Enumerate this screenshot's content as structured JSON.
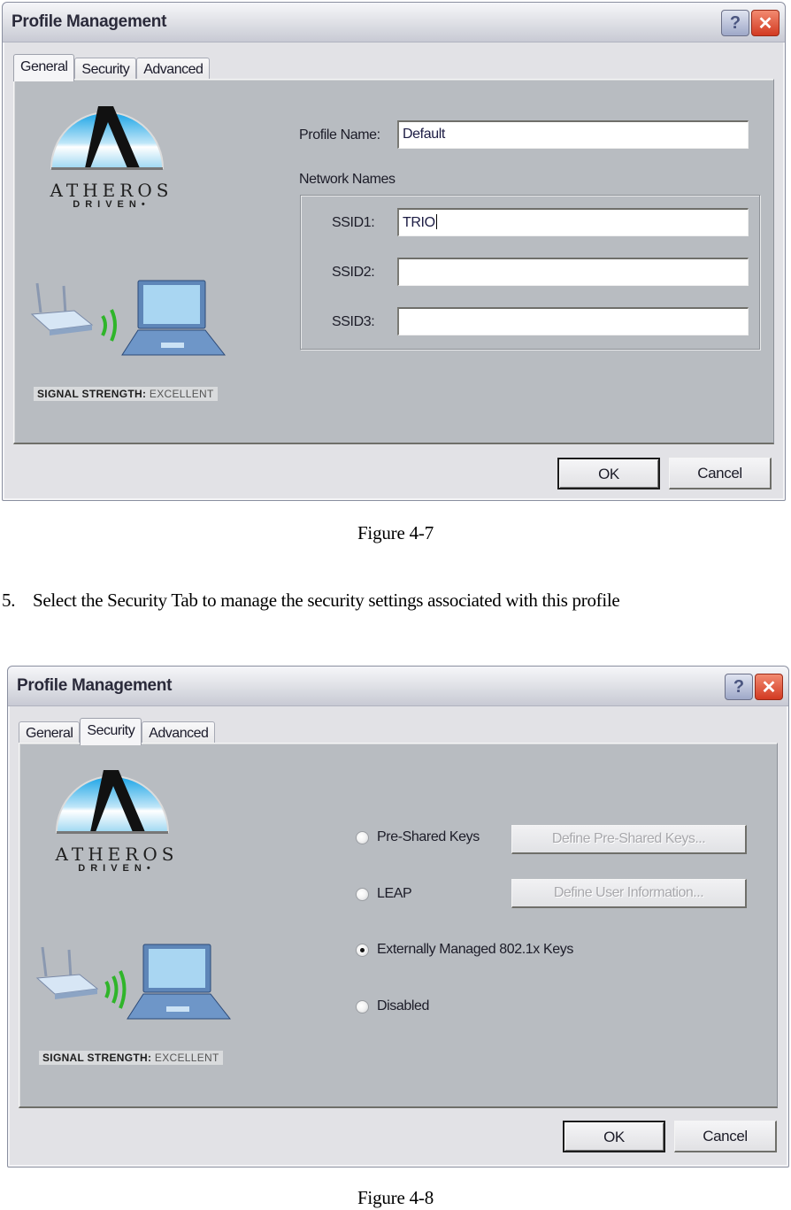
{
  "figures": [
    {
      "caption": "Figure 4-7",
      "dialog": {
        "title": "Profile Management",
        "help_icon": "question-mark-icon",
        "close_icon": "close-x-icon",
        "tabs": [
          {
            "label": "General",
            "active": true
          },
          {
            "label": "Security",
            "active": false
          },
          {
            "label": "Advanced",
            "active": false
          }
        ],
        "logo": {
          "word": "ATHEROS",
          "sub": "DRIVEN•"
        },
        "signal": {
          "label": "SIGNAL STRENGTH:",
          "value": "EXCELLENT"
        },
        "form": {
          "profile_name_label": "Profile Name:",
          "profile_name_value": "Default",
          "network_names_label": "Network Names",
          "ssids": [
            {
              "label": "SSID1:",
              "value": "TRIO"
            },
            {
              "label": "SSID2:",
              "value": ""
            },
            {
              "label": "SSID3:",
              "value": ""
            }
          ]
        },
        "buttons": {
          "ok": "OK",
          "cancel": "Cancel"
        }
      }
    },
    {
      "caption": "Figure 4-8",
      "dialog": {
        "title": "Profile Management",
        "help_icon": "question-mark-icon",
        "close_icon": "close-x-icon",
        "tabs": [
          {
            "label": "General",
            "active": false
          },
          {
            "label": "Security",
            "active": true
          },
          {
            "label": "Advanced",
            "active": false
          }
        ],
        "logo": {
          "word": "ATHEROS",
          "sub": "DRIVEN•"
        },
        "signal": {
          "label": "SIGNAL STRENGTH:",
          "value": "EXCELLENT"
        },
        "security": {
          "options": [
            {
              "label": "Pre-Shared Keys",
              "checked": false,
              "button": "Define Pre-Shared Keys...",
              "button_enabled": false
            },
            {
              "label": "LEAP",
              "checked": false,
              "button": "Define User Information...",
              "button_enabled": false
            },
            {
              "label": "Externally Managed 802.1x Keys",
              "checked": true
            },
            {
              "label": "Disabled",
              "checked": false
            }
          ]
        },
        "buttons": {
          "ok": "OK",
          "cancel": "Cancel"
        }
      }
    }
  ],
  "instruction": {
    "number": "5.",
    "text": "Select the Security Tab to manage the security settings associated with this profile"
  },
  "colors": {
    "panel_bg": "#b8bcc1",
    "dialog_bg": "#e2e2e6",
    "close_red": "#d23a22",
    "signal_green": "#2fb52a",
    "logo_sky": "#3fb6ea"
  }
}
